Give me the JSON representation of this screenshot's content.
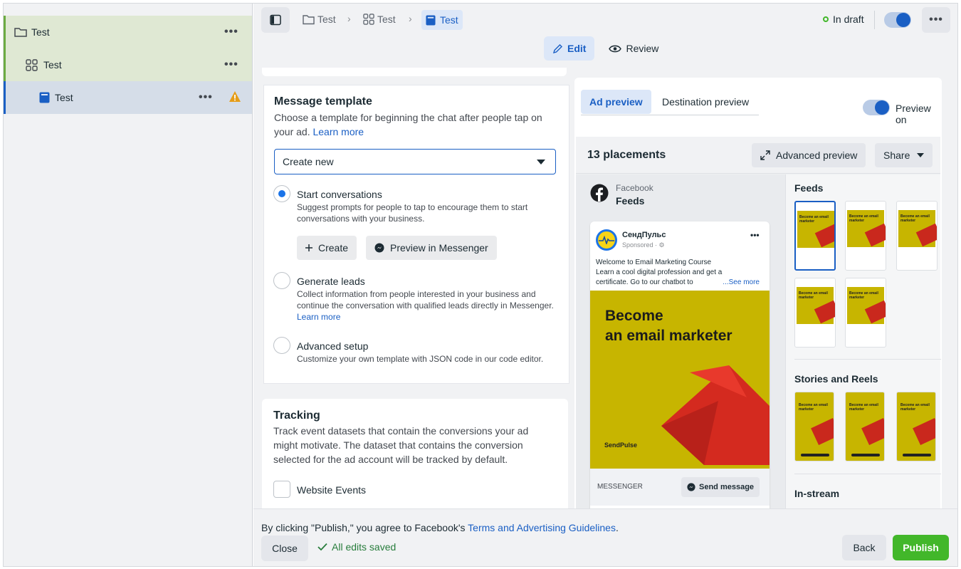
{
  "sidebar": {
    "items": [
      {
        "label": "Test",
        "icon": "folder-icon"
      },
      {
        "label": "Test",
        "icon": "grid-icon"
      },
      {
        "label": "Test",
        "icon": "ad-icon",
        "warning": true
      }
    ],
    "more_label": "•••"
  },
  "topbar": {
    "breadcrumb": [
      "Test",
      "Test",
      "Test"
    ],
    "status": "In draft",
    "more_label": "•••",
    "modes": [
      "Edit",
      "Review"
    ]
  },
  "message_template": {
    "title": "Message template",
    "description": "Choose a template for beginning the chat after people tap on your ad.",
    "learn_more": "Learn more",
    "select_value": "Create new",
    "options": [
      {
        "title": "Start conversations",
        "desc": "Suggest prompts for people to tap to encourage them to start conversations with your business.",
        "selected": true
      },
      {
        "title": "Generate leads",
        "desc": "Collect information from people interested in your business and continue the conversation with qualified leads directly in Messenger.",
        "link": "Learn more",
        "selected": false
      },
      {
        "title": "Advanced setup",
        "desc": "Customize your own template with JSON code in our code editor.",
        "selected": false
      }
    ],
    "create_button": "Create",
    "preview_button": "Preview in Messenger"
  },
  "tracking": {
    "title": "Tracking",
    "description": "Track event datasets that contain the conversions your ad might motivate. The dataset that contains the conversion selected for the ad account will be tracked by default.",
    "checkbox_label": "Website Events"
  },
  "preview": {
    "tabs": [
      "Ad preview",
      "Destination preview"
    ],
    "toggle_label": "Preview on",
    "placements_count": "13 placements",
    "advanced_preview": "Advanced preview",
    "share": "Share",
    "platform": "Facebook",
    "platform_placement": "Feeds",
    "post": {
      "page_name": "СендПульс",
      "sponsored": "Sponsored · ⚙",
      "text_line1": "Welcome to Email Marketing Course",
      "text_line2": "Learn a cool digital profession and get a",
      "text_line3": "certificate. Go to our chatbot to",
      "see_more": "...See more",
      "headline_1": "Become",
      "headline_2": "an email marketer",
      "brand": "SendPulse",
      "cta_label": "MESSENGER",
      "cta_button": "Send message"
    },
    "thumb_text": "Become an email marketer",
    "sections": [
      "Feeds",
      "Stories and Reels",
      "In-stream"
    ]
  },
  "footer": {
    "agreement_prefix": "By clicking \"Publish,\" you agree to Facebook's ",
    "agreement_link": "Terms and Advertising Guidelines",
    "agreement_suffix": ".",
    "close": "Close",
    "saved": "All edits saved",
    "back": "Back",
    "publish": "Publish"
  },
  "colors": {
    "accent": "#1a5fc4",
    "publish": "#42b72a",
    "draft": "#42b72a",
    "warning": "#e69d17"
  }
}
